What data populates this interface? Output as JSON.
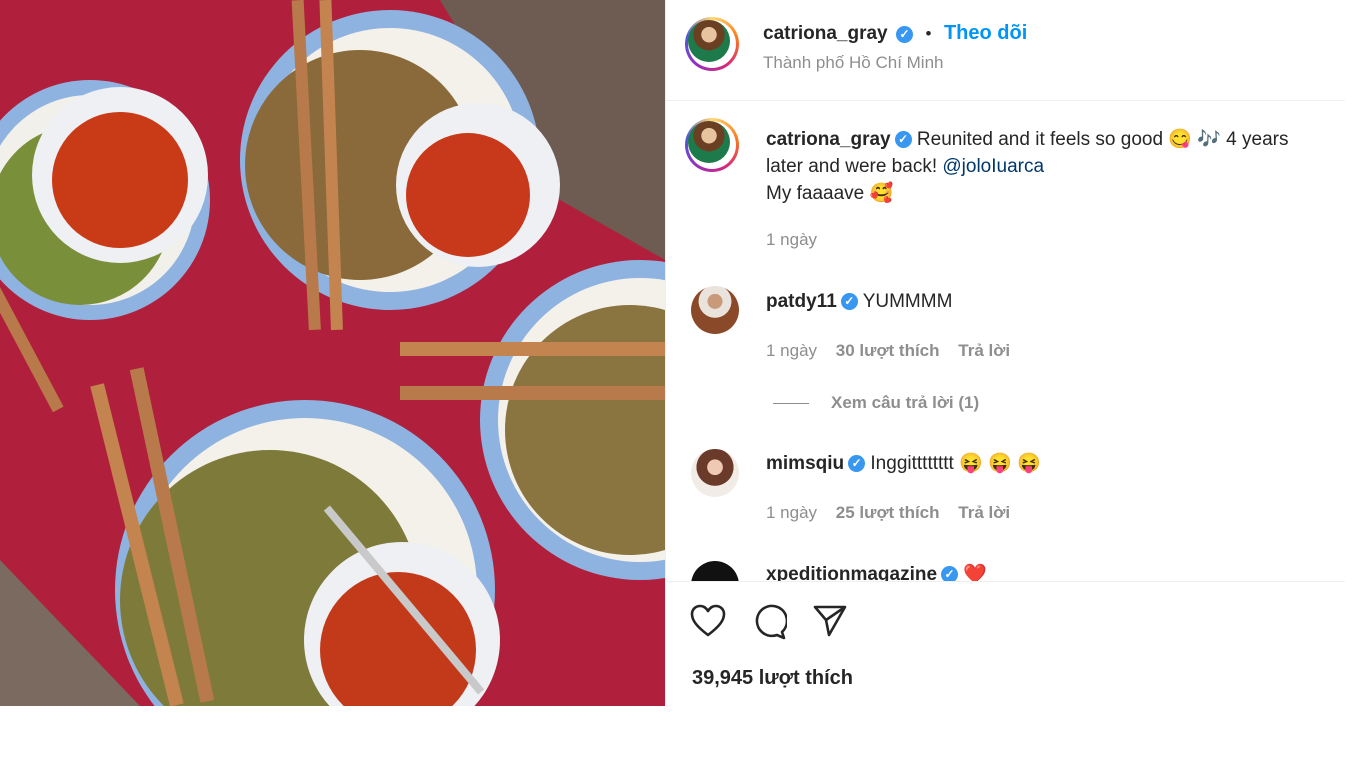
{
  "header": {
    "username": "catriona_gray",
    "follow_label": "Theo dõi",
    "location": "Thành phố Hồ Chí Minh"
  },
  "caption": {
    "username": "catriona_gray",
    "text_part1": "Reunited and it feels so good 😋 🎶 4 years",
    "text_part2": "later and were back! ",
    "mention": "@joloIuarca",
    "text_part3": "My faaaave 🥰",
    "time": "1 ngày"
  },
  "comments": [
    {
      "username": "patdy11",
      "text": "YUMMMM",
      "time": "1 ngày",
      "likes": "30 lượt thích",
      "reply": "Trả lời"
    },
    {
      "username": "mimsqiu",
      "text": "Inggitttttttt 😝 😝 😝",
      "time": "1 ngày",
      "likes": "25 lượt thích",
      "reply": "Trả lời"
    },
    {
      "username": "xpeditionmagazine",
      "text": "❤️"
    }
  ],
  "view_replies": "Xem câu trả lời (1)",
  "likes_count": "39,945 lượt thích",
  "icons": [
    "heart-icon",
    "comment-icon",
    "share-icon",
    "verified-icon"
  ],
  "colors": {
    "accent": "#0095f6",
    "verified": "#3897f0",
    "text": "#262626",
    "muted": "#8e8e8e"
  }
}
